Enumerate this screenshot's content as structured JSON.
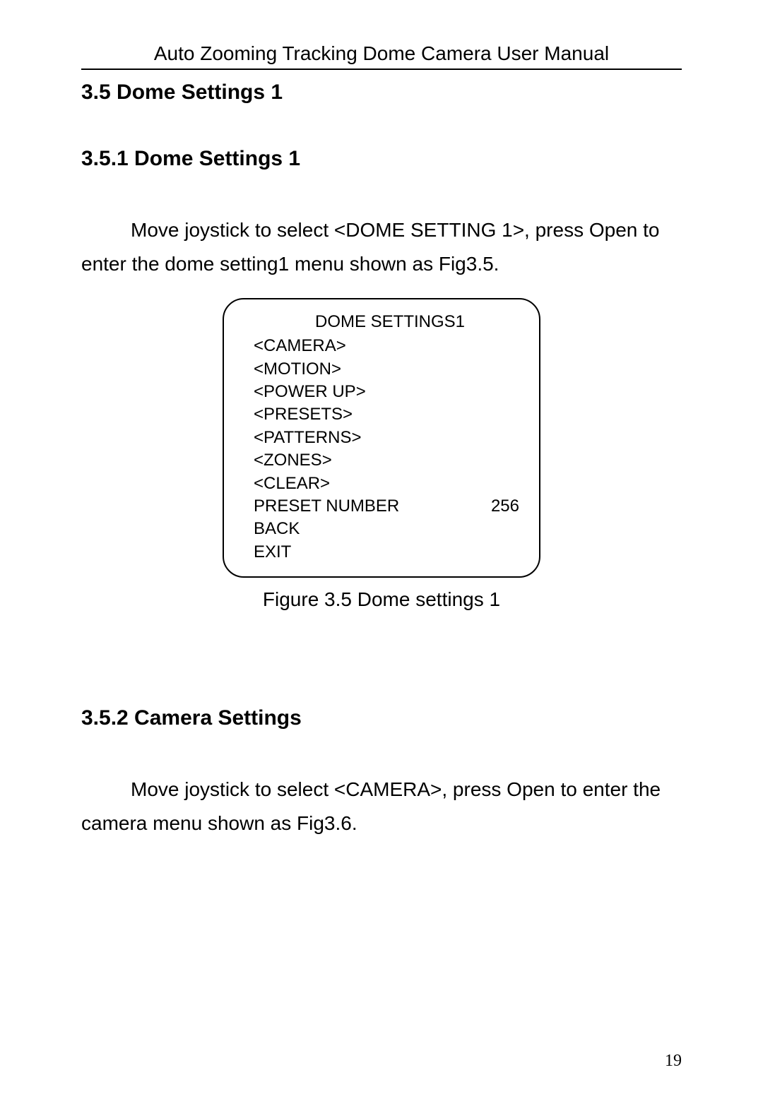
{
  "header": {
    "title": "Auto Zooming Tracking Dome Camera User Manual"
  },
  "section35": {
    "heading": "3.5 Dome Settings 1"
  },
  "section351": {
    "heading": "3.5.1 Dome Settings 1",
    "paragraph": "Move joystick to select <DOME SETTING 1>, press Open to enter the dome setting1 menu shown as Fig3.5."
  },
  "menu": {
    "title": "DOME SETTINGS1",
    "items": {
      "camera": "<CAMERA>",
      "motion": "<MOTION>",
      "powerup": "<POWER UP>",
      "presets": "<PRESETS>",
      "patterns": "<PATTERNS>",
      "zones": "<ZONES>",
      "clear": "<CLEAR>",
      "preset_number_label": "PRESET NUMBER",
      "preset_number_value": "256",
      "back": "BACK",
      "exit": "EXIT"
    }
  },
  "figure": {
    "caption": "Figure 3.5 Dome settings 1"
  },
  "section352": {
    "heading": "3.5.2 Camera Settings",
    "paragraph": "Move joystick to select <CAMERA>, press Open to enter the camera menu shown as Fig3.6."
  },
  "page": {
    "number": "19"
  }
}
